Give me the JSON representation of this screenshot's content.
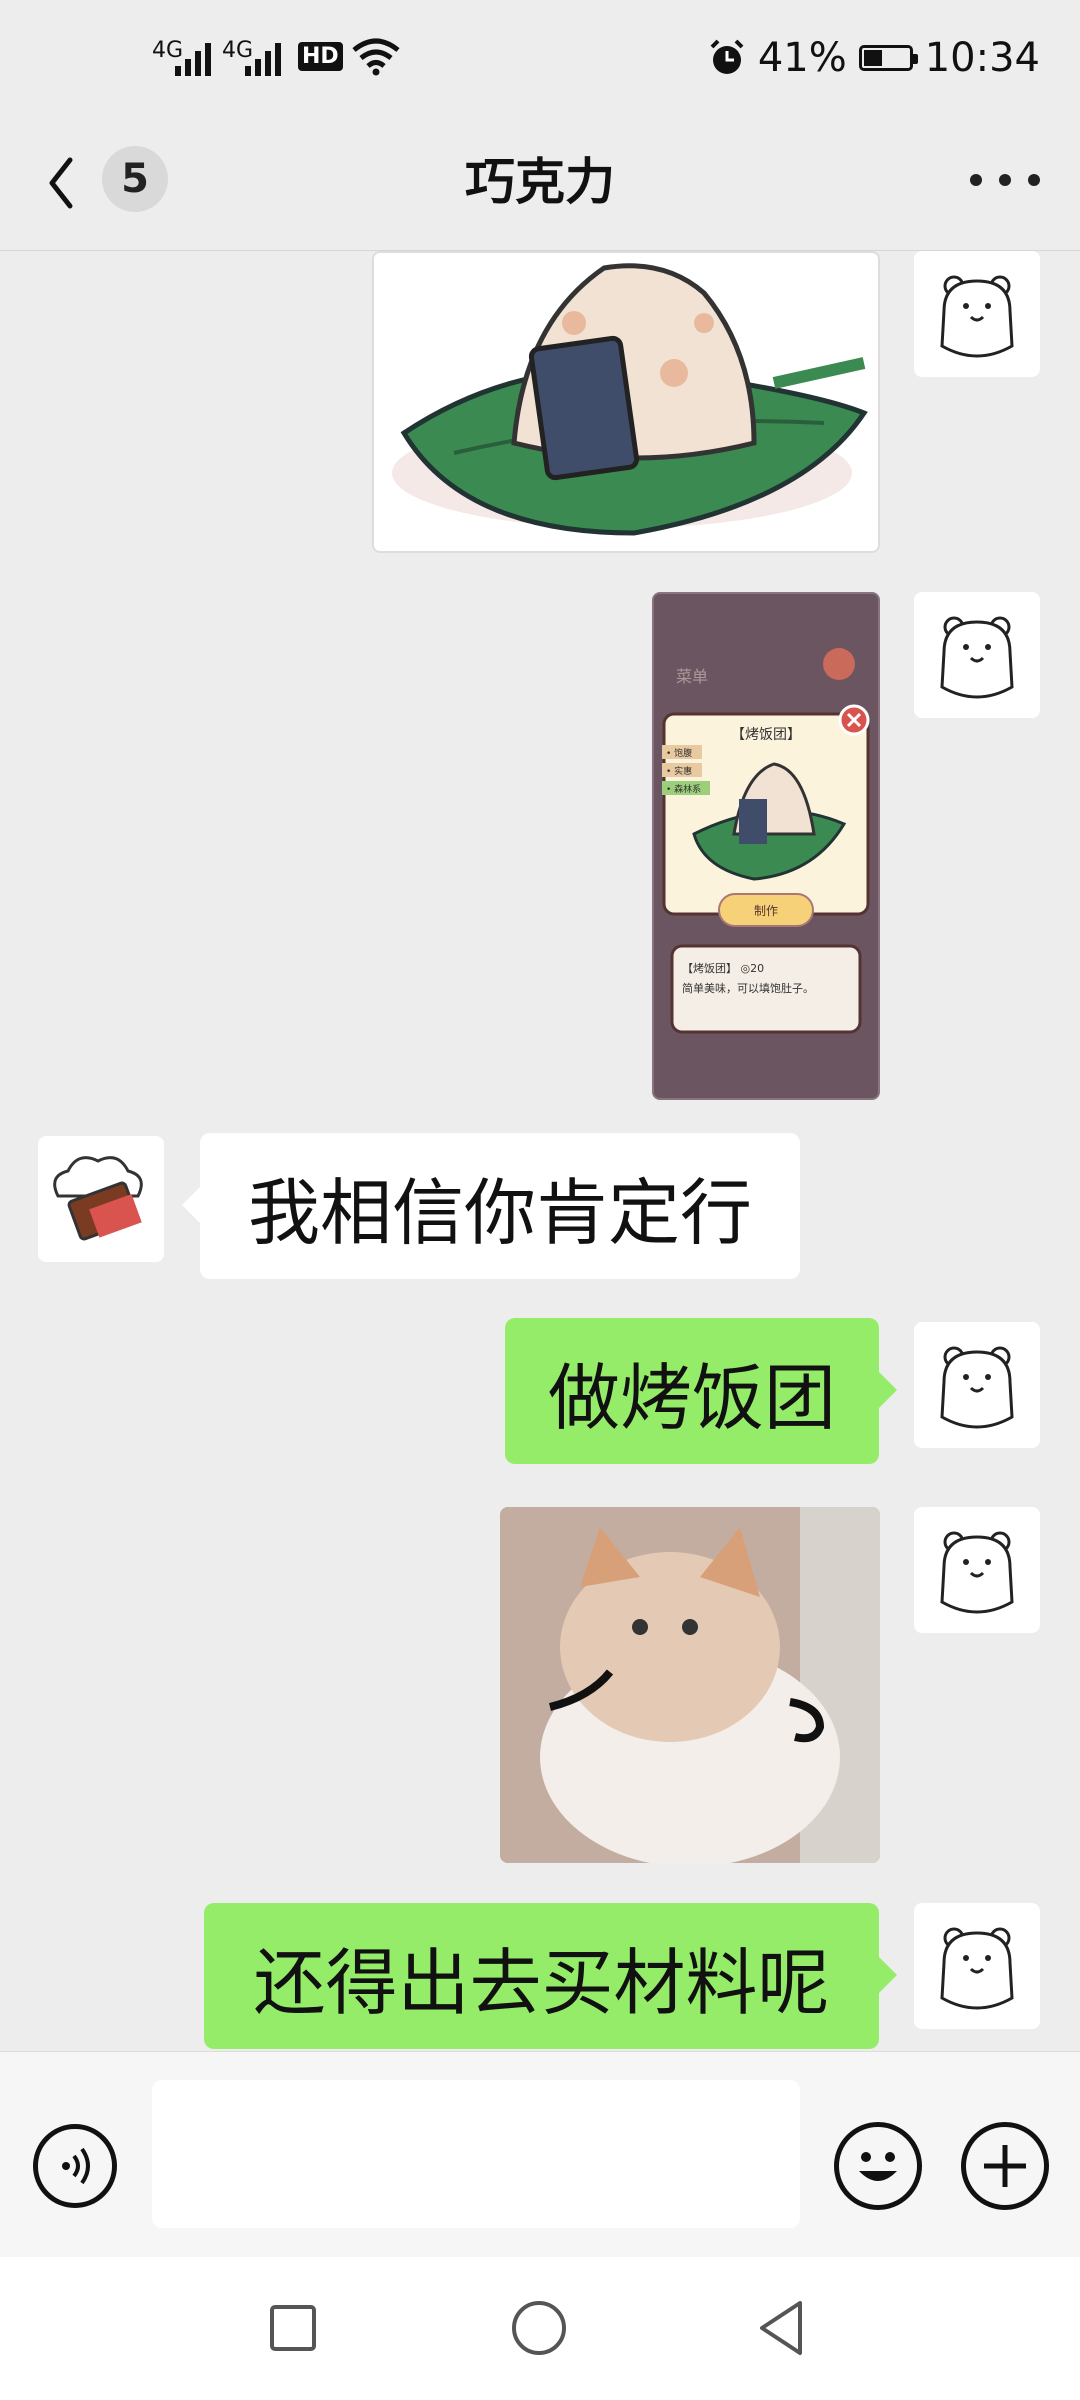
{
  "status_bar": {
    "signal_1": "4G",
    "signal_2": "4G",
    "hd": "HD",
    "battery_percent": "41%",
    "battery_level": 0.41,
    "time": "10:34"
  },
  "header": {
    "unread_count": "5",
    "title": "巧克力"
  },
  "messages": [
    {
      "side": "right",
      "type": "image",
      "icon": "rice-ball-sticker"
    },
    {
      "side": "right",
      "type": "image",
      "icon": "game-screenshot-menu",
      "screenshot_text": {
        "menu": "菜单",
        "item_title": "【烤饭团】",
        "tags": [
          "• 饱腹",
          "• 实惠",
          "• 森林系"
        ],
        "make_button": "制作",
        "desc_line1": "【烤饭团】 ◎20",
        "desc_line2": "简单美味，可以填饱肚子。"
      }
    },
    {
      "side": "left",
      "type": "text",
      "text": "我相信你肯定行"
    },
    {
      "side": "right",
      "type": "text",
      "text": "做烤饭团"
    },
    {
      "side": "right",
      "type": "image",
      "icon": "cat-meme-sticker"
    },
    {
      "side": "right",
      "type": "text",
      "text": "还得出去买材料呢"
    }
  ],
  "colors": {
    "background": "#ededed",
    "bubble_self": "#95ec69",
    "bubble_other": "#ffffff"
  },
  "icons": [
    "back-arrow-icon",
    "more-icon",
    "voice-icon",
    "emoji-icon",
    "plus-icon",
    "nav-recents-icon",
    "nav-home-icon",
    "nav-back-icon"
  ]
}
